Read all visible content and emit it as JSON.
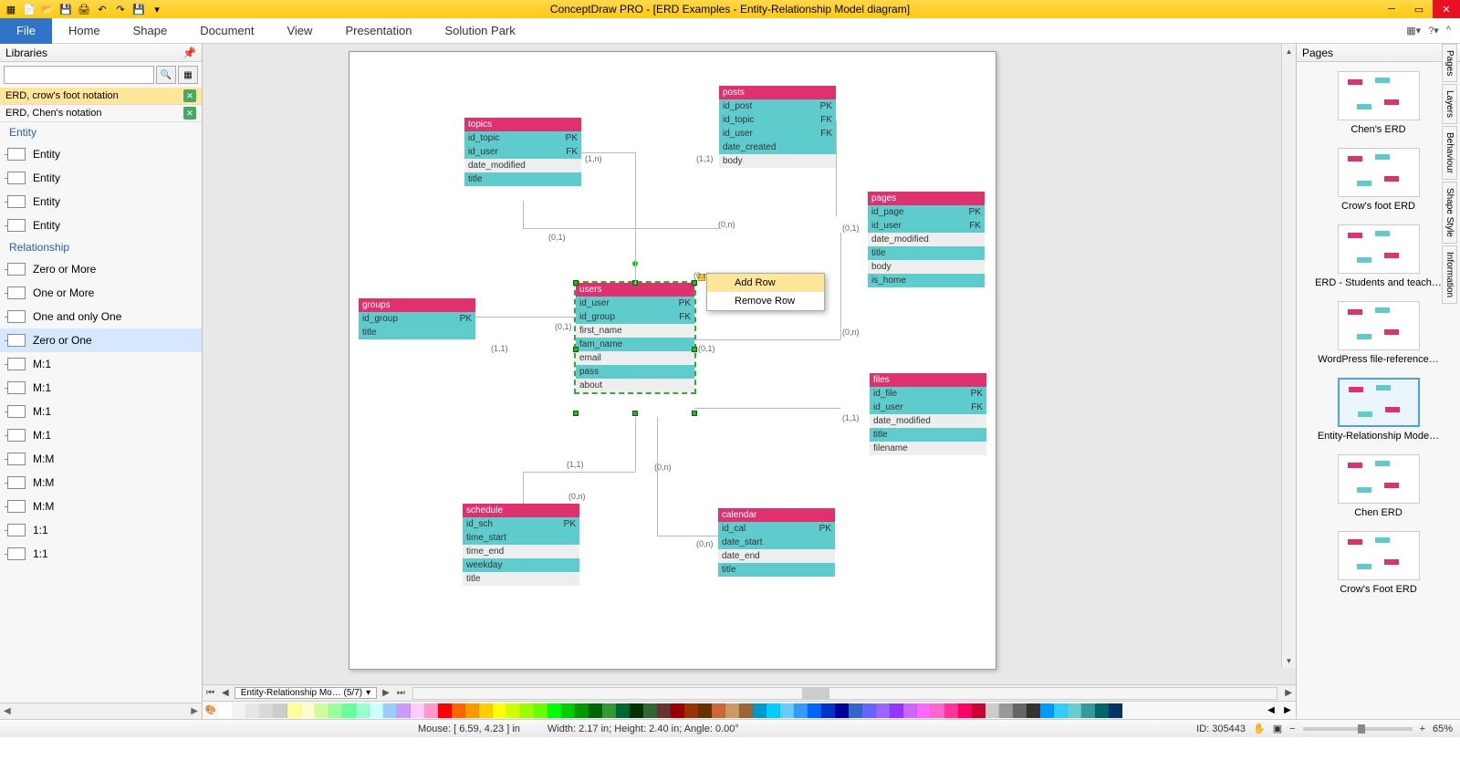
{
  "app": {
    "title": "ConceptDraw PRO - [ERD Examples - Entity-Relationship Model diagram]"
  },
  "ribbon": {
    "file": "File",
    "tabs": [
      "Home",
      "Shape",
      "Document",
      "View",
      "Presentation",
      "Solution Park"
    ]
  },
  "libraries": {
    "title": "Libraries",
    "search_placeholder": "",
    "tags": [
      {
        "label": "ERD, crow's foot notation",
        "active": true
      },
      {
        "label": "ERD, Chen's notation",
        "active": false
      }
    ],
    "sections": [
      {
        "heading": "Entity",
        "items": [
          "Entity",
          "Entity",
          "Entity",
          "Entity"
        ]
      },
      {
        "heading": "Relationship",
        "items": [
          "Zero or More",
          "One or More",
          "One and only One",
          "Zero or One",
          "M:1",
          "M:1",
          "M:1",
          "M:1",
          "M:M",
          "M:M",
          "M:M",
          "1:1",
          "1:1"
        ]
      }
    ],
    "selected_item": "Zero or One"
  },
  "canvas": {
    "popup": {
      "add": "Add Row",
      "remove": "Remove Row"
    },
    "entities": {
      "topics": {
        "title": "topics",
        "rows": [
          [
            "id_topic",
            "PK"
          ],
          [
            "id_user",
            "FK"
          ],
          [
            "date_modified",
            ""
          ],
          [
            "title",
            ""
          ]
        ]
      },
      "posts": {
        "title": "posts",
        "rows": [
          [
            "id_post",
            "PK"
          ],
          [
            "id_topic",
            "FK"
          ],
          [
            "id_user",
            "FK"
          ],
          [
            "date_created",
            ""
          ],
          [
            "body",
            ""
          ]
        ]
      },
      "pages": {
        "title": "pages",
        "rows": [
          [
            "id_page",
            "PK"
          ],
          [
            "id_user",
            "FK"
          ],
          [
            "date_modified",
            ""
          ],
          [
            "title",
            ""
          ],
          [
            "body",
            ""
          ],
          [
            "is_home",
            ""
          ]
        ]
      },
      "groups": {
        "title": "groups",
        "rows": [
          [
            "id_group",
            "PK"
          ],
          [
            "title",
            ""
          ]
        ]
      },
      "users": {
        "title": "users",
        "rows": [
          [
            "id_user",
            "PK"
          ],
          [
            "id_group",
            "FK"
          ],
          [
            "first_name",
            ""
          ],
          [
            "fam_name",
            ""
          ],
          [
            "email",
            ""
          ],
          [
            "pass",
            ""
          ],
          [
            "about",
            ""
          ]
        ]
      },
      "files": {
        "title": "files",
        "rows": [
          [
            "id_file",
            "PK"
          ],
          [
            "id_user",
            "FK"
          ],
          [
            "date_modified",
            ""
          ],
          [
            "title",
            ""
          ],
          [
            "filename",
            ""
          ]
        ]
      },
      "schedule": {
        "title": "schedule",
        "rows": [
          [
            "id_sch",
            "PK"
          ],
          [
            "time_start",
            ""
          ],
          [
            "time_end",
            ""
          ],
          [
            "weekday",
            ""
          ],
          [
            "title",
            ""
          ]
        ]
      },
      "calendar": {
        "title": "calendar",
        "rows": [
          [
            "id_cal",
            "PK"
          ],
          [
            "date_start",
            ""
          ],
          [
            "date_end",
            ""
          ],
          [
            "title",
            ""
          ]
        ]
      }
    },
    "cardinalities": [
      "(1,n)",
      "(1,1)",
      "(0,1)",
      "(0,n)",
      "(0,1)",
      "(1,1)",
      "(0,n)",
      "(0,1)",
      "(0,n)",
      "(0,1)",
      "(1,1)",
      "(1,1)",
      "(0,n)",
      "(0,n)",
      "(0,n)"
    ]
  },
  "pages_panel": {
    "title": "Pages",
    "thumbs": [
      "Chen's ERD",
      "Crow's foot ERD",
      "ERD - Students and teach…",
      "WordPress file-reference…",
      "Entity-Relationship Mode…",
      "Chen ERD",
      "Crow's Foot ERD"
    ],
    "selected": 4
  },
  "sidetabs": [
    "Pages",
    "Layers",
    "Behaviour",
    "Shape Style",
    "Information"
  ],
  "tabbar": {
    "page_label": "Entity-Relationship Mo…  (5/7)"
  },
  "statusbar": {
    "mouse": "Mouse: [ 6.59, 4.23 ] in",
    "size": "Width: 2.17 in;  Height: 2.40 in;  Angle: 0.00°",
    "id": "ID: 305443",
    "zoom": "65%"
  },
  "palette_colors": [
    "#ffffff",
    "#f2f2f2",
    "#e6e6e6",
    "#d9d9d9",
    "#cccccc",
    "#ffff99",
    "#ffffcc",
    "#ccff99",
    "#99ff99",
    "#66ff99",
    "#99ffcc",
    "#ccffff",
    "#99ccff",
    "#cc99ff",
    "#ffccff",
    "#ff99cc",
    "#ff0000",
    "#ff6600",
    "#ff9900",
    "#ffcc00",
    "#ffff00",
    "#ccff00",
    "#99ff00",
    "#66ff00",
    "#00ff00",
    "#00cc00",
    "#009900",
    "#006600",
    "#339933",
    "#006633",
    "#003300",
    "#336633",
    "#663333",
    "#990000",
    "#993300",
    "#663300",
    "#cc6633",
    "#cc9966",
    "#996633",
    "#0099cc",
    "#00ccff",
    "#66ccff",
    "#3399ff",
    "#0066ff",
    "#0033cc",
    "#000099",
    "#3366cc",
    "#6666ff",
    "#9966ff",
    "#9933ff",
    "#cc66ff",
    "#ff66ff",
    "#ff66cc",
    "#ff3399",
    "#ff0066",
    "#cc0033",
    "#cccccc",
    "#999999",
    "#666666",
    "#333333",
    "#0099ff",
    "#33ccff",
    "#66cccc",
    "#339999",
    "#006666",
    "#003366"
  ]
}
